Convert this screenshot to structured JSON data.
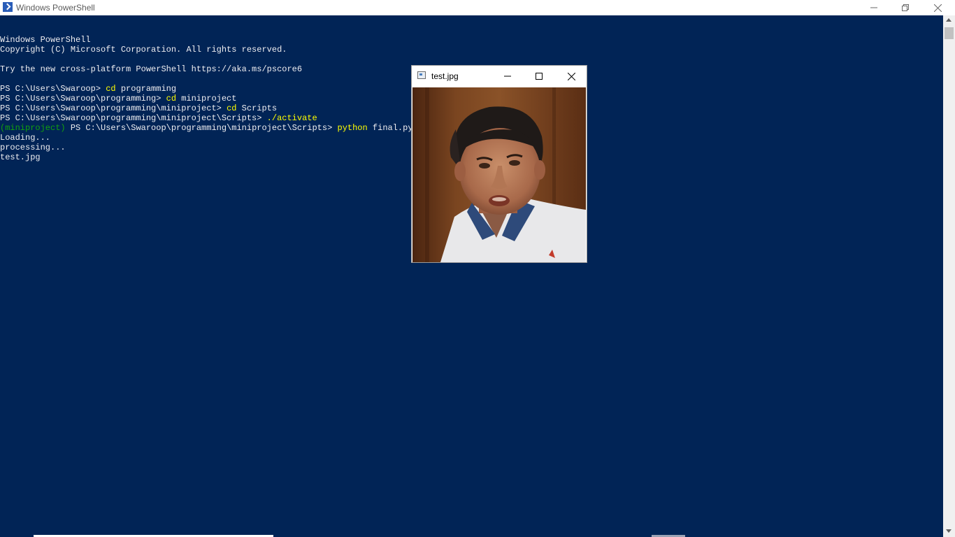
{
  "window": {
    "title": "Windows PowerShell",
    "icon": "powershell-icon",
    "controls": [
      "minimize-icon",
      "restore-icon",
      "close-icon"
    ]
  },
  "terminal": {
    "background": "#012456",
    "lines": [
      {
        "prefix": "",
        "cmd": "",
        "rest": "Windows PowerShell"
      },
      {
        "prefix": "",
        "cmd": "",
        "rest": "Copyright (C) Microsoft Corporation. All rights reserved."
      },
      {
        "prefix": "",
        "cmd": "",
        "rest": ""
      },
      {
        "prefix": "",
        "cmd": "",
        "rest": "Try the new cross-platform PowerShell https://aka.ms/pscore6"
      },
      {
        "prefix": "",
        "cmd": "",
        "rest": ""
      },
      {
        "prefix": "PS C:\\Users\\Swaroop> ",
        "cmd": "cd",
        "rest": " programming"
      },
      {
        "prefix": "PS C:\\Users\\Swaroop\\programming> ",
        "cmd": "cd",
        "rest": " miniproject"
      },
      {
        "prefix": "PS C:\\Users\\Swaroop\\programming\\miniproject> ",
        "cmd": "cd",
        "rest": " Scripts"
      },
      {
        "prefix": "PS C:\\Users\\Swaroop\\programming\\miniproject\\Scripts> ",
        "cmd": "./activate",
        "rest": ""
      },
      {
        "env": "(miniproject)",
        "prefix": " PS C:\\Users\\Swaroop\\programming\\miniproject\\Scripts> ",
        "cmd": "python",
        "rest": " final.py"
      },
      {
        "prefix": "",
        "cmd": "",
        "rest": "Loading..."
      },
      {
        "prefix": "",
        "cmd": "",
        "rest": "processing..."
      },
      {
        "prefix": "",
        "cmd": "",
        "rest": "test.jpg"
      }
    ]
  },
  "image_window": {
    "title": "test.jpg",
    "icon": "image-window-icon",
    "controls": [
      "minimize-icon",
      "maximize-icon",
      "close-icon"
    ],
    "image": "photo-of-man"
  }
}
